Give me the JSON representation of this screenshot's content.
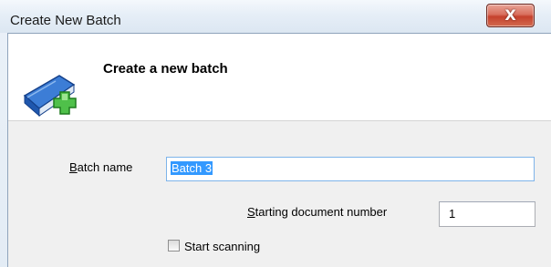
{
  "window": {
    "title": "Create New Batch",
    "close_glyph": "X"
  },
  "header": {
    "title": "Create a new batch",
    "icon": "book-add-icon"
  },
  "form": {
    "batch_name": {
      "label_accel": "B",
      "label_rest": "atch name",
      "value": "Batch 3"
    },
    "starting_document_number": {
      "label_accel": "S",
      "label_rest": "tarting document number",
      "value": "1"
    },
    "start_scanning": {
      "label": "Start scanning",
      "checked": false
    }
  },
  "colors": {
    "selection": "#3399ff",
    "close_button": "#c5412d",
    "focus_border": "#7eb4ea"
  }
}
